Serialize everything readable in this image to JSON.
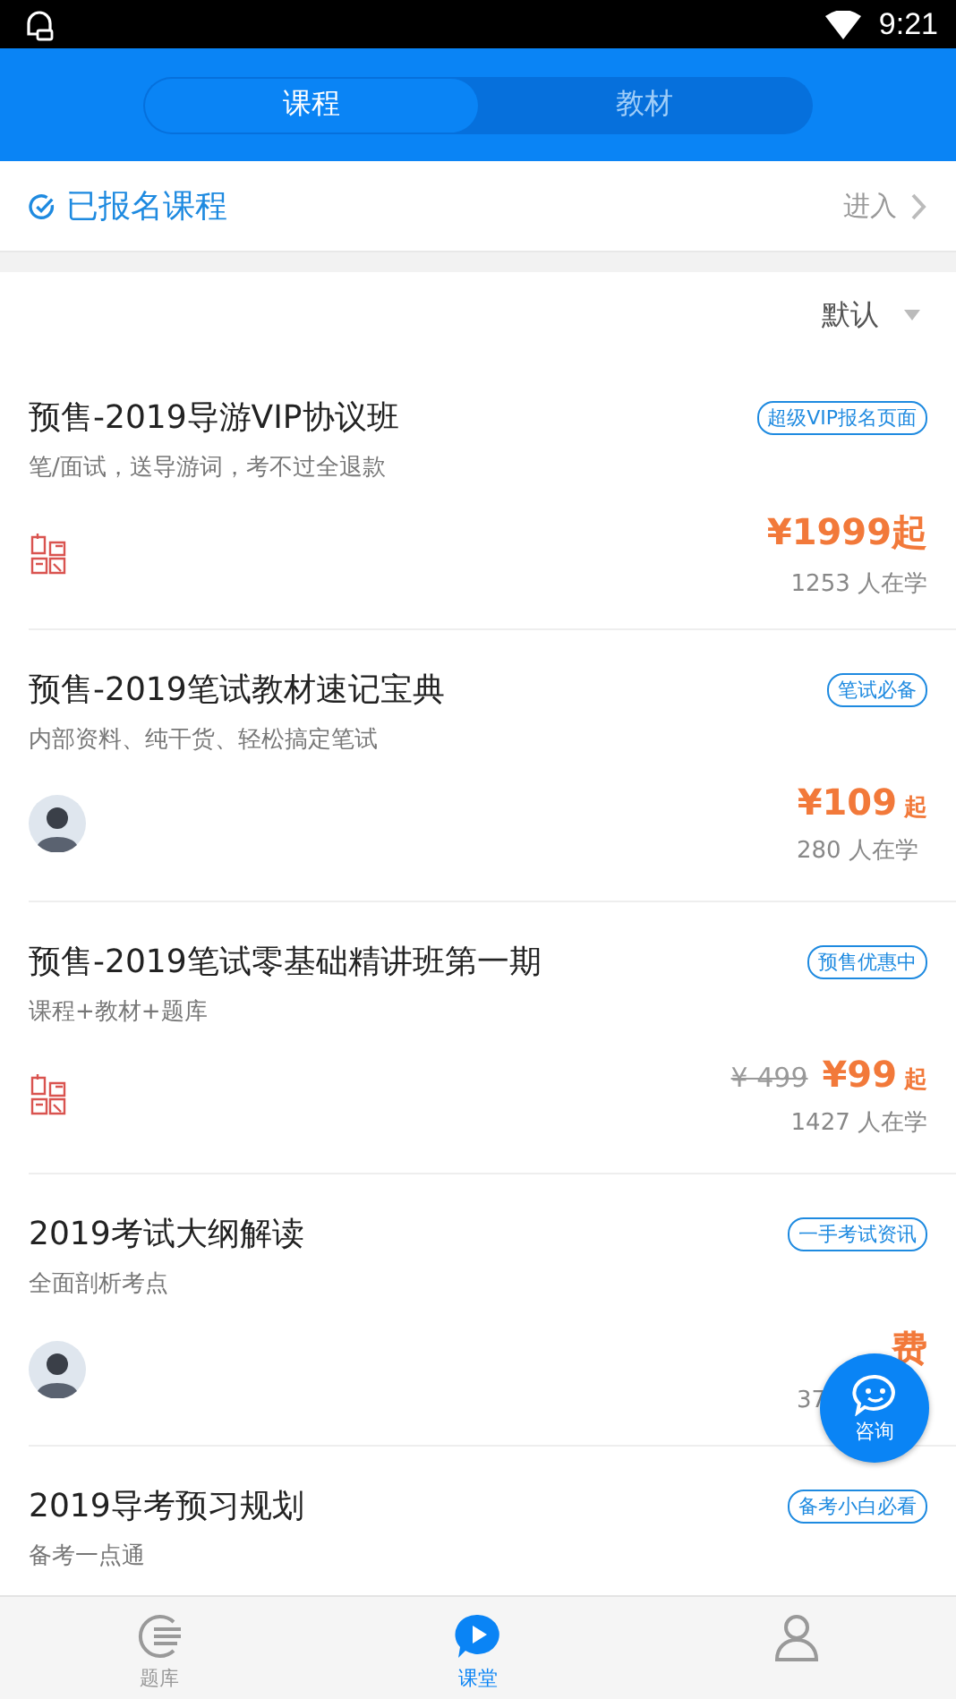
{
  "status_bar": {
    "time": "9:21"
  },
  "tabs": [
    {
      "label": "课程",
      "selected": true
    },
    {
      "label": "教材",
      "selected": false
    }
  ],
  "enrolled": {
    "label": "已报名课程",
    "action": "进入"
  },
  "sort": {
    "label": "默认"
  },
  "courses": [
    {
      "title": "预售-2019导游VIP协议班",
      "subtitle": "笔/面试，送导游词，考不过全退款",
      "tag": "超级VIP报名页面",
      "kind": "seal",
      "price": "¥1999起",
      "students": "1253 人在学"
    },
    {
      "title": "预售-2019笔试教材速记宝典",
      "subtitle": "内部资料、纯干货、轻松搞定笔试",
      "tag": "笔试必备",
      "kind": "avatar",
      "price": "¥109",
      "suffix": "起",
      "students": "280 人在学"
    },
    {
      "title": "预售-2019笔试零基础精讲班第一期",
      "subtitle": "课程+教材+题库",
      "tag": "预售优惠中",
      "kind": "seal",
      "original_price": "¥ 499",
      "price": "¥99",
      "suffix": "起",
      "students": "1427 人在学"
    },
    {
      "title": "2019考试大纲解读",
      "subtitle": "全面剖析考点",
      "tag": "一手考试资讯",
      "kind": "avatar",
      "price": "费",
      "students": "37"
    },
    {
      "title": "2019导考预习规划",
      "subtitle": "备考一点通",
      "tag": "备考小白必看"
    }
  ],
  "fab": {
    "label": "咨询"
  },
  "nav": [
    {
      "kind": "list",
      "label": "题库",
      "selected": false
    },
    {
      "kind": "play",
      "label": "课堂",
      "selected": true
    },
    {
      "kind": "person",
      "selected": false
    }
  ]
}
